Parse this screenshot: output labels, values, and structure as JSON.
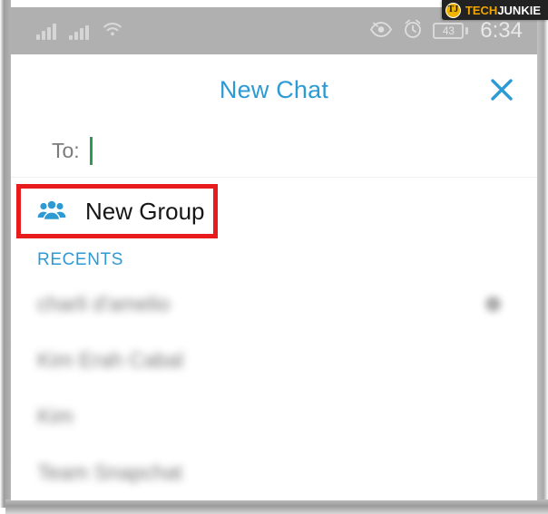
{
  "watermark": {
    "badge_text": "TJ",
    "brand_first": "TECH",
    "brand_second": "JUNKIE",
    "accent_color": "#f0a500"
  },
  "status_bar": {
    "signal_1": "signal-bars-icon",
    "signal_2": "signal-bars-icon",
    "wifi": "wifi-icon",
    "eye": "eye-icon",
    "alarm": "alarm-clock-icon",
    "battery_percent": "43",
    "time": "6:34",
    "background_color": "#b0b0b0"
  },
  "header": {
    "title": "New Chat",
    "title_color": "#2c9ad6",
    "close_icon": "close-x-icon"
  },
  "compose": {
    "to_label": "To:",
    "to_value": "",
    "to_placeholder": "",
    "caret_color": "#2e9b52"
  },
  "new_group": {
    "label": "New Group",
    "icon": "group-people-icon",
    "icon_color": "#2e9ad4",
    "highlight_color": "#e81c1c",
    "highlighted": true
  },
  "recents": {
    "header": "RECENTS",
    "header_color": "#2e9ad4",
    "contacts": [
      {
        "name": "charli d'amelio",
        "has_mark": true
      },
      {
        "name": "Kim Erah Cabal",
        "has_mark": false
      },
      {
        "name": "Kim",
        "has_mark": false
      },
      {
        "name": "Team Snapchat",
        "has_mark": false
      }
    ]
  }
}
